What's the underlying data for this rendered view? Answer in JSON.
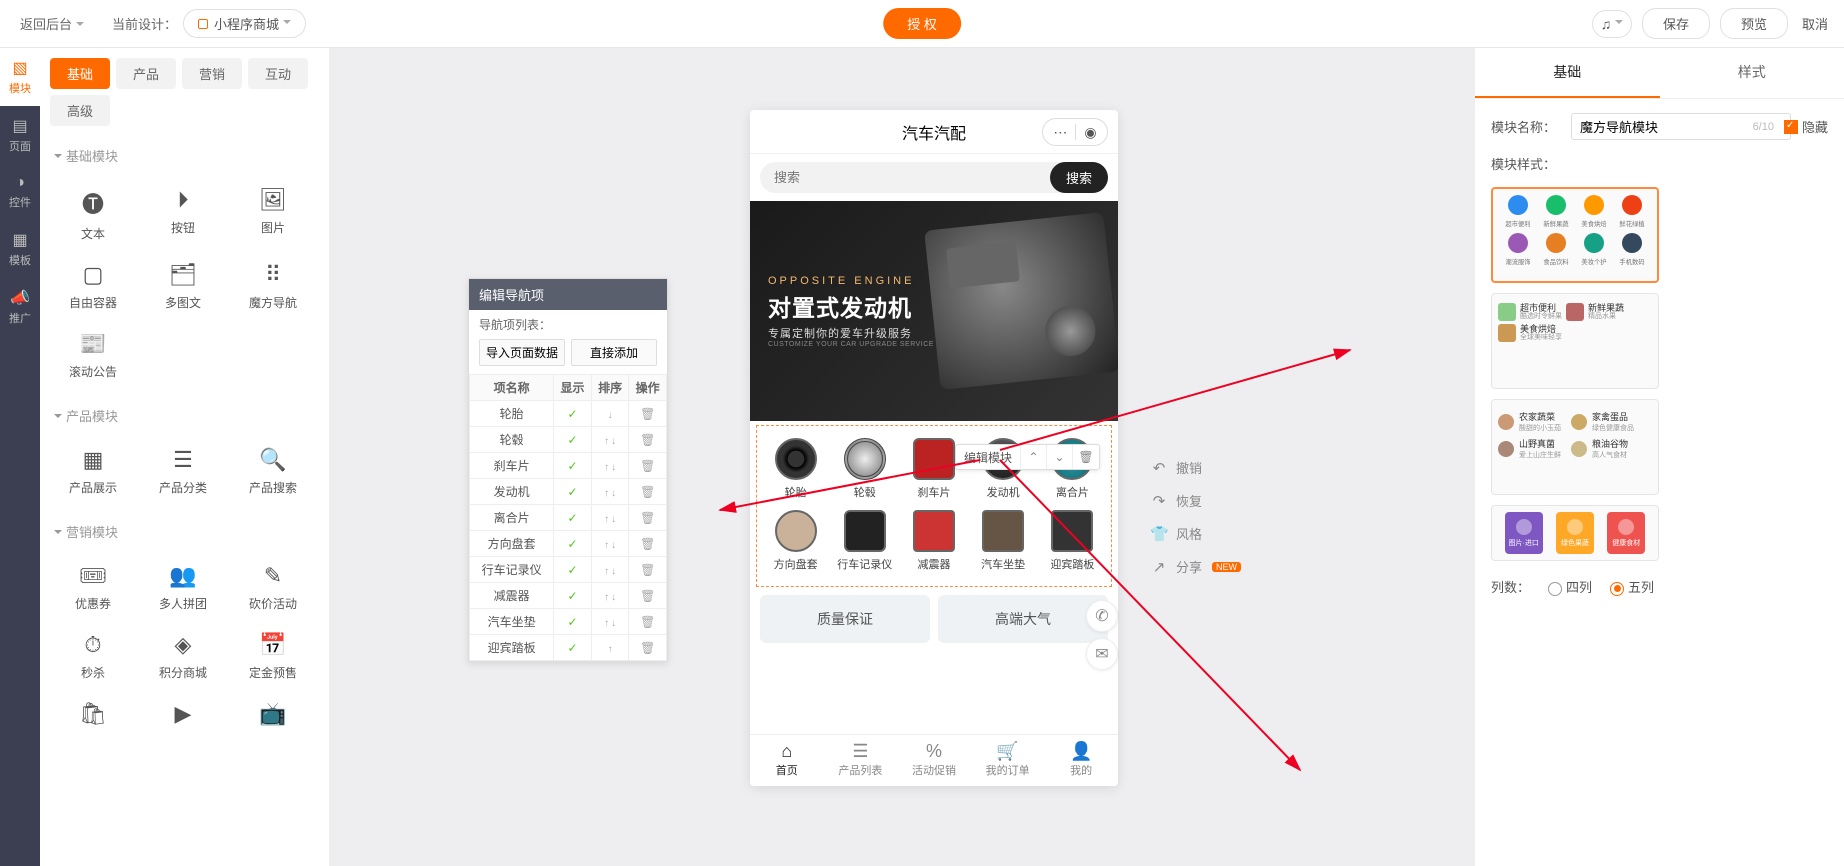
{
  "header": {
    "back": "返回后台",
    "current_design_label": "当前设计：",
    "design_name": "小程序商城",
    "auth_button": "授 权",
    "save": "保存",
    "preview": "预览",
    "cancel": "取消"
  },
  "left_nav": {
    "modules": "模块",
    "page": "页面",
    "controls": "控件",
    "template": "模板",
    "promote": "推广"
  },
  "module_tabs": {
    "basic": "基础",
    "product": "产品",
    "marketing": "营销",
    "interact": "互动",
    "advanced": "高级"
  },
  "sections": {
    "basic": "基础模块",
    "product": "产品模块",
    "marketing": "营销模块"
  },
  "modules_basic": {
    "text": "文本",
    "button": "按钮",
    "image": "图片",
    "free_container": "自由容器",
    "multi_image": "多图文",
    "cube_nav": "魔方导航",
    "scroll_notice": "滚动公告"
  },
  "modules_product": {
    "product_show": "产品展示",
    "product_category": "产品分类",
    "product_search": "产品搜索"
  },
  "modules_marketing": {
    "coupon": "优惠券",
    "group_buy": "多人拼团",
    "bargain": "砍价活动",
    "seckill": "秒杀",
    "points_mall": "积分商城",
    "deposit": "定金预售"
  },
  "nav_editor": {
    "title": "编辑导航项",
    "list_label": "导航项列表：",
    "import_btn": "导入页面数据",
    "add_btn": "直接添加",
    "cols": {
      "name": "项名称",
      "show": "显示",
      "sort": "排序",
      "op": "操作"
    },
    "items": [
      {
        "name": "轮胎"
      },
      {
        "name": "轮毂"
      },
      {
        "name": "刹车片"
      },
      {
        "name": "发动机"
      },
      {
        "name": "离合片"
      },
      {
        "name": "方向盘套"
      },
      {
        "name": "行车记录仪"
      },
      {
        "name": "减震器"
      },
      {
        "name": "汽车坐垫"
      },
      {
        "name": "迎宾踏板"
      }
    ]
  },
  "phone": {
    "title": "汽车汽配",
    "search_placeholder": "搜索",
    "search_btn": "搜索",
    "banner_tag": "OPPOSITE ENGINE",
    "banner_title": "对置式发动机",
    "banner_sub": "专属定制你的爱车升级服务",
    "banner_en": "CUSTOMIZE YOUR CAR UPGRADE SERVICE",
    "edit_module": "编辑模块",
    "cube_items": [
      "轮胎",
      "轮毂",
      "刹车片",
      "发动机",
      "离合片",
      "方向盘套",
      "行车记录仪",
      "减震器",
      "汽车坐垫",
      "迎宾踏板"
    ],
    "promo1": "质量保证",
    "promo2": "高端大气",
    "tabbar": [
      "首页",
      "产品列表",
      "活动促销",
      "我的订单",
      "我的"
    ]
  },
  "phone_actions": {
    "undo": "撤销",
    "redo": "恢复",
    "style": "风格",
    "share": "分享",
    "new_badge": "NEW"
  },
  "right_panel": {
    "tab_basic": "基础",
    "tab_style": "样式",
    "name_label": "模块名称：",
    "name_value": "魔方导航模块",
    "name_count": "6/10",
    "hide_label": "隐藏",
    "style_label": "模块样式：",
    "cols_label": "列数：",
    "cols_4": "四列",
    "cols_5": "五列",
    "sc2": {
      "r1a": "超市便利",
      "r1b": "酷选时令鲜果",
      "r2a": "新鲜果蔬",
      "r2b": "精品水果",
      "r3a": "美食烘焙",
      "r3b": "全球美味轻享"
    },
    "sc3": {
      "r1a": "农家蔬菜",
      "r1b": "酸甜的小玉茄",
      "r2a": "家禽蛋品",
      "r2b": "绿色健康食品",
      "r3a": "山野真菌",
      "r3b": "爱上山庄生鲜",
      "r4a": "粮油谷物",
      "r4b": "高人气食材"
    },
    "sc1_labels": [
      "超市便利",
      "新鲜果蔬",
      "美食烘焙",
      "鲜花绿植",
      "潮流服饰",
      "食品饮料",
      "美妆个护",
      "手机数码"
    ],
    "sc4_labels": [
      "图片·进口",
      "绿色果蔬",
      "健康食材"
    ]
  }
}
